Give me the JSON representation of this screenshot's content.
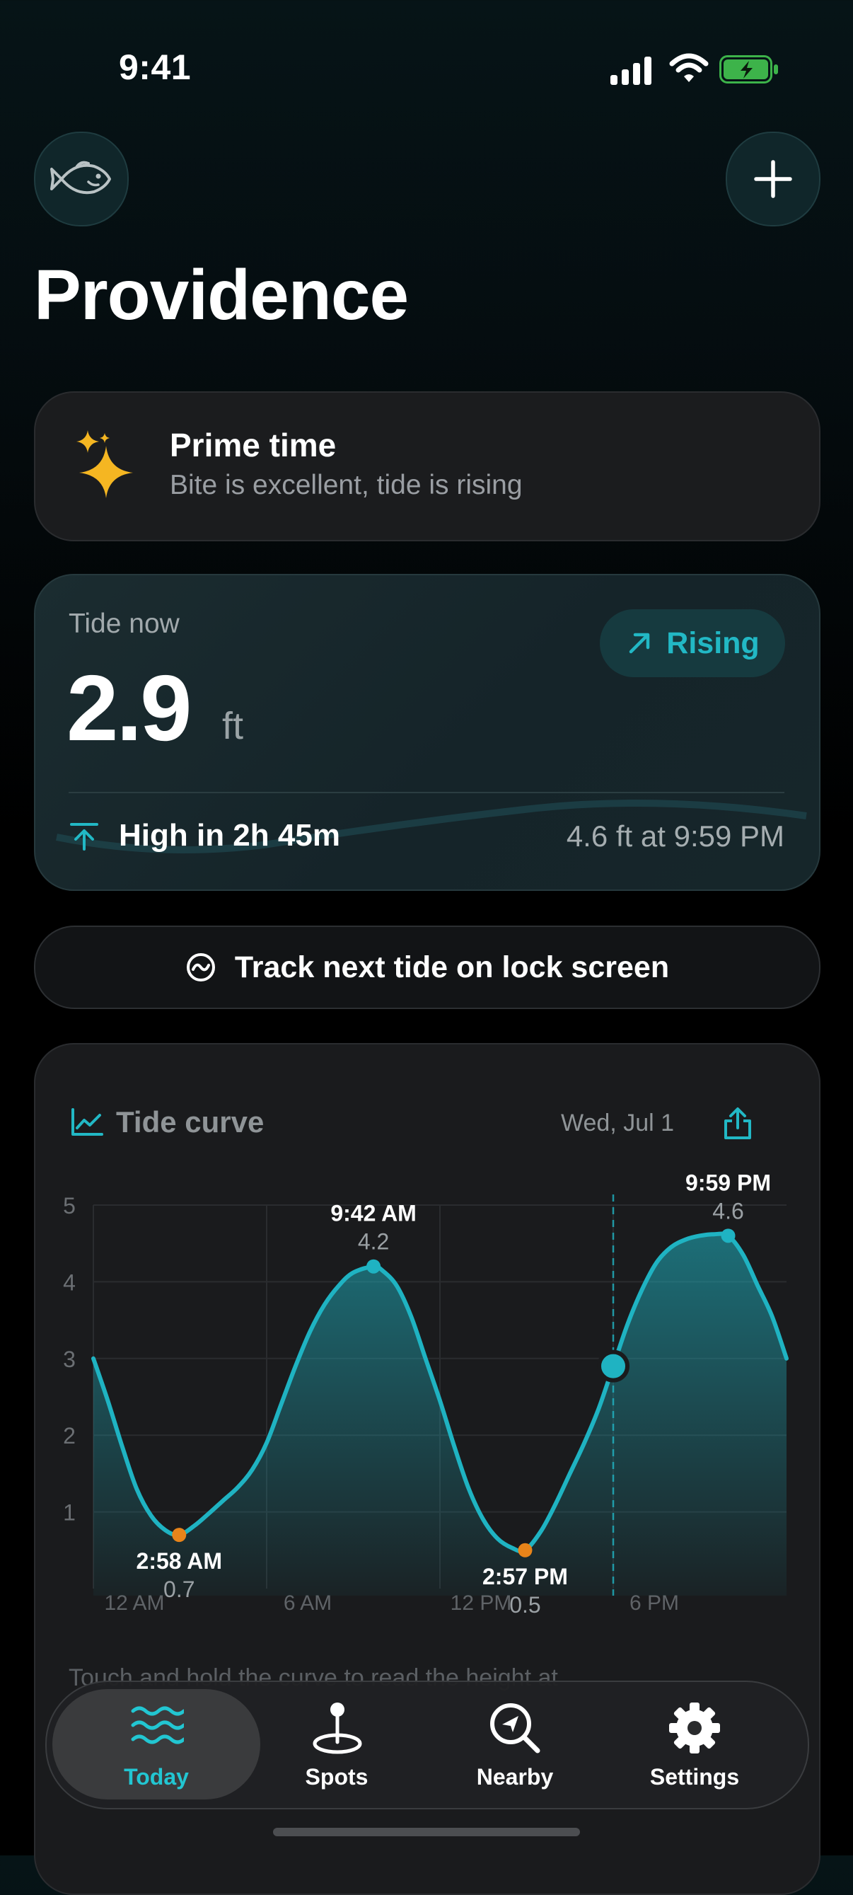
{
  "status_bar": {
    "time": "9:41"
  },
  "header": {
    "city": "Providence"
  },
  "prime": {
    "title": "Prime time",
    "subtitle": "Bite is excellent, tide is rising"
  },
  "tide_now": {
    "label": "Tide now",
    "value": "2.9",
    "unit": "ft",
    "trend": "Rising",
    "next_label": "High in 2h 45m",
    "next_detail": "4.6 ft at 9:59 PM"
  },
  "lock_screen": {
    "label": "Track next tide on lock screen"
  },
  "tide_curve": {
    "title": "Tide curve",
    "date": "Wed, Jul 1",
    "hint": "Touch and hold the curve to read the height at"
  },
  "chart_data": {
    "type": "area",
    "x_unit": "hour of day",
    "xlim": [
      0,
      24
    ],
    "ylim": [
      0,
      5
    ],
    "y_ticks": [
      1,
      2,
      3,
      4,
      5
    ],
    "x_ticks": [
      {
        "value": 0,
        "label": "12 AM"
      },
      {
        "value": 6,
        "label": "6 AM"
      },
      {
        "value": 12,
        "label": "12 PM"
      },
      {
        "value": 18,
        "label": "6 PM"
      }
    ],
    "extremes": [
      {
        "x": 2.97,
        "y": 0.7,
        "time": "2:58 AM",
        "height": "0.7",
        "kind": "low"
      },
      {
        "x": 9.7,
        "y": 4.2,
        "time": "9:42 AM",
        "height": "4.2",
        "kind": "high"
      },
      {
        "x": 14.95,
        "y": 0.5,
        "time": "2:57 PM",
        "height": "0.5",
        "kind": "low"
      },
      {
        "x": 21.98,
        "y": 4.6,
        "time": "9:59 PM",
        "height": "4.6",
        "kind": "high"
      }
    ],
    "current": {
      "x": 18.0,
      "y": 2.9
    },
    "curve": [
      [
        0,
        3.0
      ],
      [
        0.5,
        2.45
      ],
      [
        1,
        1.85
      ],
      [
        1.5,
        1.3
      ],
      [
        2,
        0.95
      ],
      [
        2.5,
        0.76
      ],
      [
        2.97,
        0.7
      ],
      [
        3.5,
        0.82
      ],
      [
        4,
        0.98
      ],
      [
        4.5,
        1.15
      ],
      [
        5,
        1.32
      ],
      [
        5.5,
        1.55
      ],
      [
        6,
        1.9
      ],
      [
        6.5,
        2.4
      ],
      [
        7,
        2.9
      ],
      [
        7.5,
        3.35
      ],
      [
        8,
        3.7
      ],
      [
        8.5,
        3.95
      ],
      [
        9,
        4.12
      ],
      [
        9.7,
        4.2
      ],
      [
        10,
        4.15
      ],
      [
        10.5,
        3.95
      ],
      [
        11,
        3.55
      ],
      [
        11.5,
        3.0
      ],
      [
        12,
        2.45
      ],
      [
        12.5,
        1.85
      ],
      [
        13,
        1.3
      ],
      [
        13.5,
        0.9
      ],
      [
        14,
        0.65
      ],
      [
        14.5,
        0.53
      ],
      [
        14.95,
        0.5
      ],
      [
        15.5,
        0.75
      ],
      [
        16,
        1.1
      ],
      [
        16.5,
        1.5
      ],
      [
        17,
        1.9
      ],
      [
        17.5,
        2.35
      ],
      [
        18,
        2.9
      ],
      [
        18.5,
        3.45
      ],
      [
        19,
        3.9
      ],
      [
        19.5,
        4.25
      ],
      [
        20,
        4.45
      ],
      [
        20.5,
        4.55
      ],
      [
        21,
        4.6
      ],
      [
        21.5,
        4.62
      ],
      [
        21.98,
        4.6
      ],
      [
        22.5,
        4.35
      ],
      [
        23,
        3.95
      ],
      [
        23.5,
        3.55
      ],
      [
        24,
        3.0
      ]
    ],
    "colors": {
      "line": "#1fb3c2",
      "low_marker": "#e8841a",
      "high_marker": "#1fb3c2",
      "current_marker": "#1fb3c2"
    }
  },
  "tabs": [
    {
      "label": "Today",
      "icon": "waves-icon",
      "active": true
    },
    {
      "label": "Spots",
      "icon": "pin-icon",
      "active": false
    },
    {
      "label": "Nearby",
      "icon": "compass-search-icon",
      "active": false
    },
    {
      "label": "Settings",
      "icon": "gear-icon",
      "active": false
    }
  ],
  "colors": {
    "accent": "#22b8c5",
    "prime_star": "#f5b622",
    "background": "#000000"
  }
}
